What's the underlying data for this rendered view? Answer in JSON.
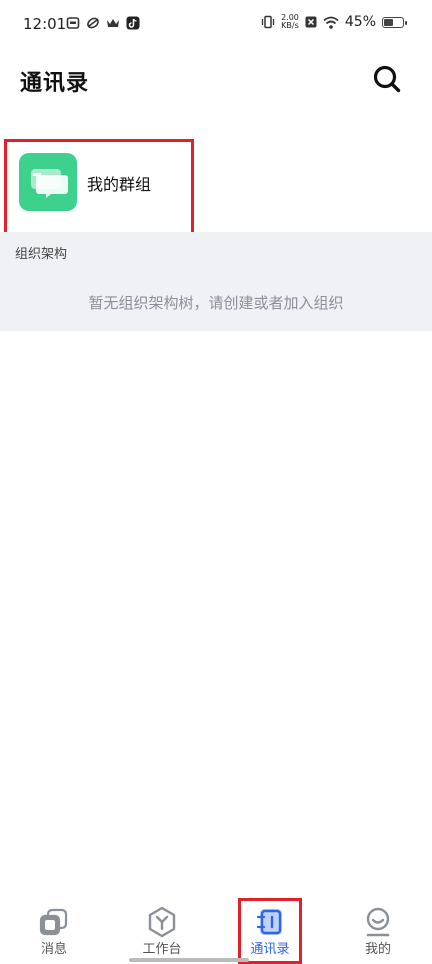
{
  "status_bar": {
    "time": "12:01",
    "net_speed_value": "2.00",
    "net_speed_unit": "KB/s",
    "battery_percent": "45%",
    "battery_level": 0.45
  },
  "header": {
    "title": "通讯录"
  },
  "groups": {
    "label": "我的群组"
  },
  "org": {
    "header": "组织架构",
    "empty_text": "暂无组织架构树，请创建或者加入组织"
  },
  "tabs": [
    {
      "label": "消息",
      "icon": "chat-icon"
    },
    {
      "label": "工作台",
      "icon": "workbench-icon"
    },
    {
      "label": "通讯录",
      "icon": "contacts-icon"
    },
    {
      "label": "我的",
      "icon": "profile-icon"
    }
  ],
  "colors": {
    "accent": "#2f65e8",
    "group_icon": "#3ed08d",
    "highlight": "#e0202a",
    "section_bg": "#f0f1f4"
  }
}
